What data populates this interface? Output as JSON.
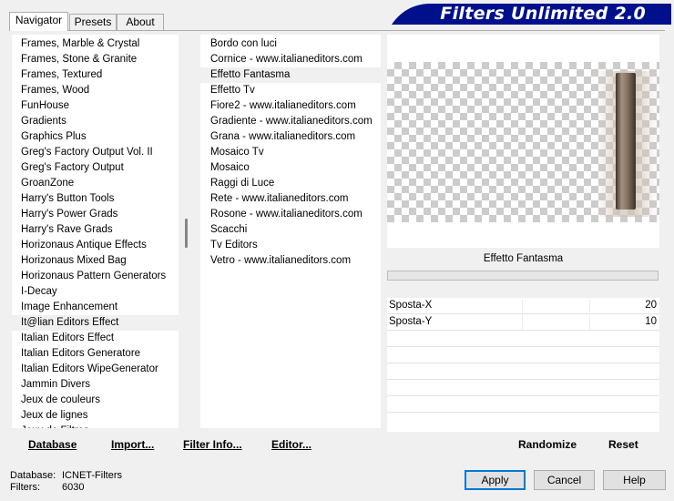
{
  "tabs": {
    "navigator": "Navigator",
    "presets": "Presets",
    "about": "About"
  },
  "banner": {
    "title": "Filters Unlimited 2.0",
    "color": "#00108c"
  },
  "categories": [
    "Frames, Marble & Crystal",
    "Frames, Stone & Granite",
    "Frames, Textured",
    "Frames, Wood",
    "FunHouse",
    "Gradients",
    "Graphics Plus",
    "Greg's Factory Output Vol. II",
    "Greg's Factory Output",
    "GroanZone",
    "Harry's Button Tools",
    "Harry's Power Grads",
    "Harry's Rave Grads",
    "Horizonaus Antique Effects",
    "Horizonaus Mixed Bag",
    "Horizonaus Pattern Generators",
    "I-Decay",
    "Image Enhancement",
    "It@lian Editors Effect",
    "Italian Editors Effect",
    "Italian Editors Generatore",
    "Italian Editors WipeGenerator",
    "Jammin Divers",
    "Jeux de couleurs",
    "Jeux de lignes",
    "Jeux de Filtres"
  ],
  "selected_category": "It@lian Editors Effect",
  "filters": [
    "Bordo con luci",
    "Cornice - www.italianeditors.com",
    "Effetto Fantasma",
    "Effetto Tv",
    "Fiore2 - www.italianeditors.com",
    "Gradiente - www.italianeditors.com",
    "Grana - www.italianeditors.com",
    "Mosaico Tv",
    "Mosaico",
    "Raggi di Luce",
    "Rete - www.italianeditors.com",
    "Rosone - www.italianeditors.com",
    "Scacchi",
    "Tv Editors",
    "Vetro - www.italianeditors.com"
  ],
  "selected_filter": "Effetto Fantasma",
  "preview": {
    "filter_name": "Effetto Fantasma"
  },
  "params": [
    {
      "label": "Sposta-X",
      "value": "20"
    },
    {
      "label": "Sposta-Y",
      "value": "10"
    }
  ],
  "toolbar": {
    "database": "Database",
    "import": "Import...",
    "filter_info": "Filter Info...",
    "editor": "Editor...",
    "randomize": "Randomize",
    "reset": "Reset"
  },
  "status": {
    "database_label": "Database:",
    "database_value": "ICNET-Filters",
    "filters_label": "Filters:",
    "filters_value": "6030"
  },
  "buttons": {
    "apply": "Apply",
    "cancel": "Cancel",
    "help": "Help"
  }
}
